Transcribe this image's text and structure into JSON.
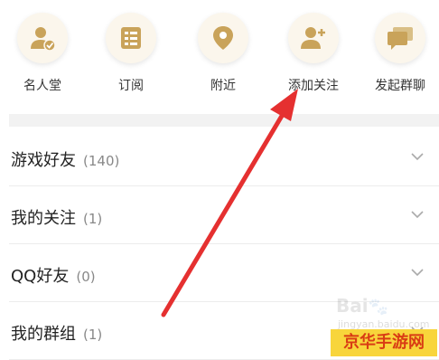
{
  "quick_actions": [
    {
      "label": "名人堂",
      "icon": "user-check-icon"
    },
    {
      "label": "订阅",
      "icon": "list-document-icon"
    },
    {
      "label": "附近",
      "icon": "location-pin-icon"
    },
    {
      "label": "添加关注",
      "icon": "user-add-icon"
    },
    {
      "label": "发起群聊",
      "icon": "chat-bubbles-icon"
    }
  ],
  "groups": [
    {
      "name": "游戏好友",
      "count": "(140)"
    },
    {
      "name": "我的关注",
      "count": "(1)"
    },
    {
      "name": "QQ好友",
      "count": "(0)"
    },
    {
      "name": "我的群组",
      "count": "(1)"
    }
  ],
  "watermark": {
    "baidu": "Bai",
    "jingyan": "jingyan.baidu.com",
    "badge": "京华手游网"
  },
  "colors": {
    "icon_gold": "#c9a35a",
    "arrow_red": "#e53030",
    "badge_yellow": "#f8d53b"
  }
}
